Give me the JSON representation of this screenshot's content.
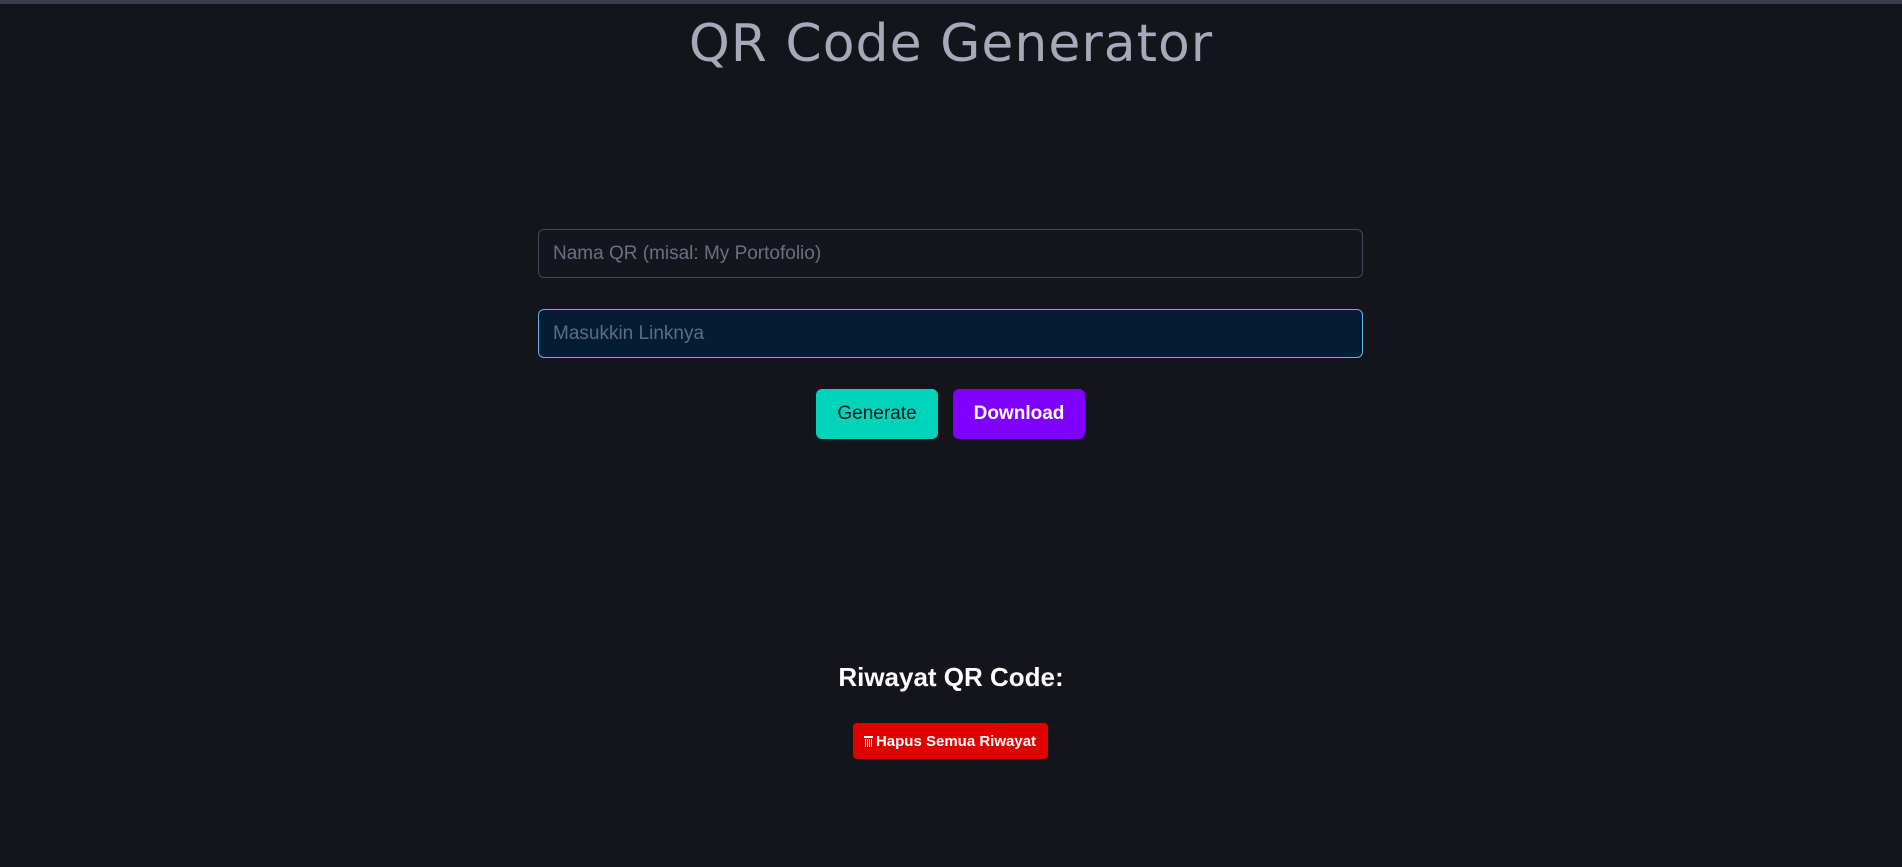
{
  "header": {
    "title": "QR Code Generator"
  },
  "form": {
    "name_placeholder": "Nama QR (misal: My Portofolio)",
    "name_value": "",
    "link_placeholder": "Masukkin Linknya",
    "link_value": ""
  },
  "actions": {
    "generate_label": "Generate",
    "download_label": "Download"
  },
  "history": {
    "title": "Riwayat QR Code:",
    "clear_label": "Hapus Semua Riwayat",
    "clear_icon": "trash-icon"
  },
  "colors": {
    "background": "#14141b",
    "generate": "#00d4b8",
    "download": "#8000ff",
    "clear": "#e00000",
    "focus_border": "#5fb4e6"
  }
}
